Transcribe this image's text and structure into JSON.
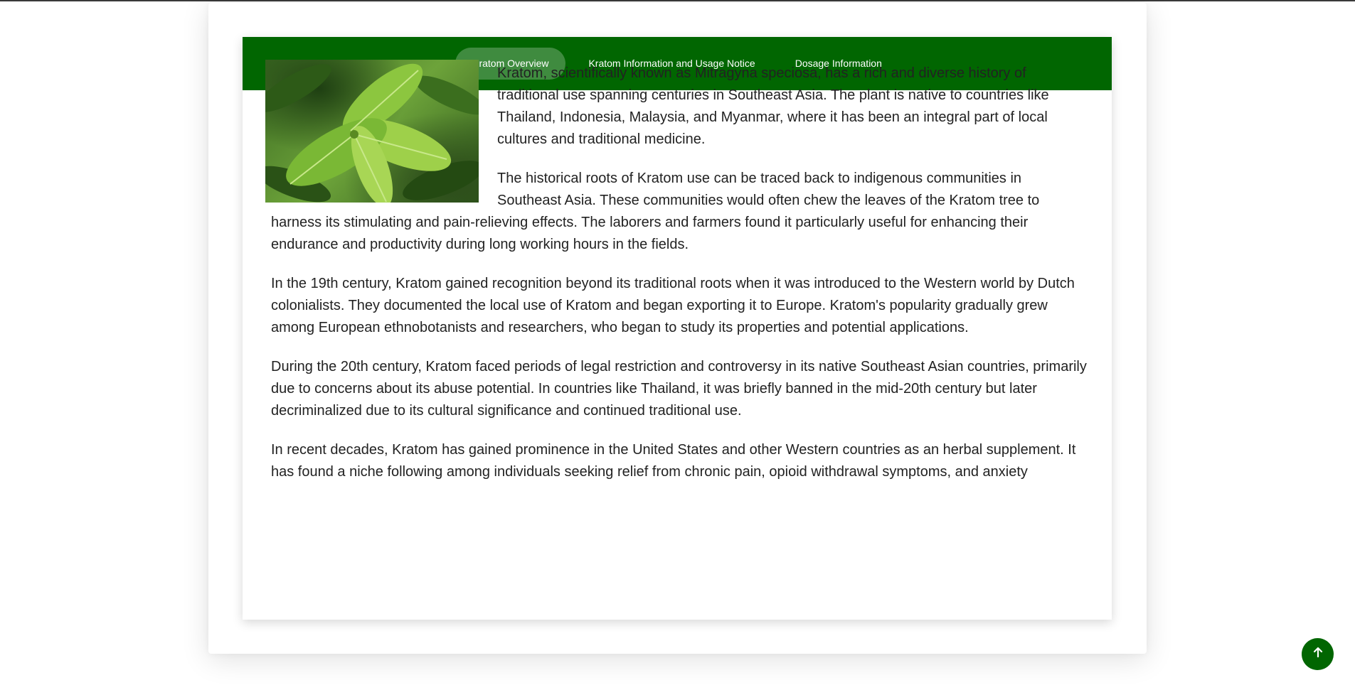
{
  "nav": {
    "tabs": [
      {
        "label": "Kratom Overview",
        "active": true
      },
      {
        "label": "Kratom Information and Usage Notice",
        "active": false
      },
      {
        "label": "Dosage Information",
        "active": false
      }
    ]
  },
  "article": {
    "image_subject": "kratom leaf plant photo",
    "paragraphs": [
      "Kratom, scientifically known as Mitragyna speciosa, has a rich and diverse history of traditional use spanning centuries in Southeast Asia. The plant is native to countries like Thailand, Indonesia, Malaysia, and Myanmar, where it has been an integral part of local cultures and traditional medicine.",
      "The historical roots of Kratom use can be traced back to indigenous communities in Southeast Asia. These communities would often chew the leaves of the Kratom tree to harness its stimulating and pain-relieving effects. The laborers and farmers found it particularly useful for enhancing their endurance and productivity during long working hours in the fields.",
      "In the 19th century, Kratom gained recognition beyond its traditional roots when it was introduced to the Western world by Dutch colonialists. They documented the local use of Kratom and began exporting it to Europe. Kratom's popularity gradually grew among European ethnobotanists and researchers, who began to study its properties and potential applications.",
      "During the 20th century, Kratom faced periods of legal restriction and controversy in its native Southeast Asian countries, primarily due to concerns about its abuse potential. In countries like Thailand, it was briefly banned in the mid-20th century but later decriminalized due to its cultural significance and continued traditional use.",
      "In recent decades, Kratom has gained prominence in the United States and other Western countries as an herbal supplement. It has found a niche following among individuals seeking relief from chronic pain, opioid withdrawal symptoms, and anxiety"
    ]
  },
  "scroll_top": {
    "icon": "arrow-up-icon"
  },
  "colors": {
    "brand_green": "#016601",
    "active_tab": "#3f8b3f",
    "text": "#222222"
  }
}
